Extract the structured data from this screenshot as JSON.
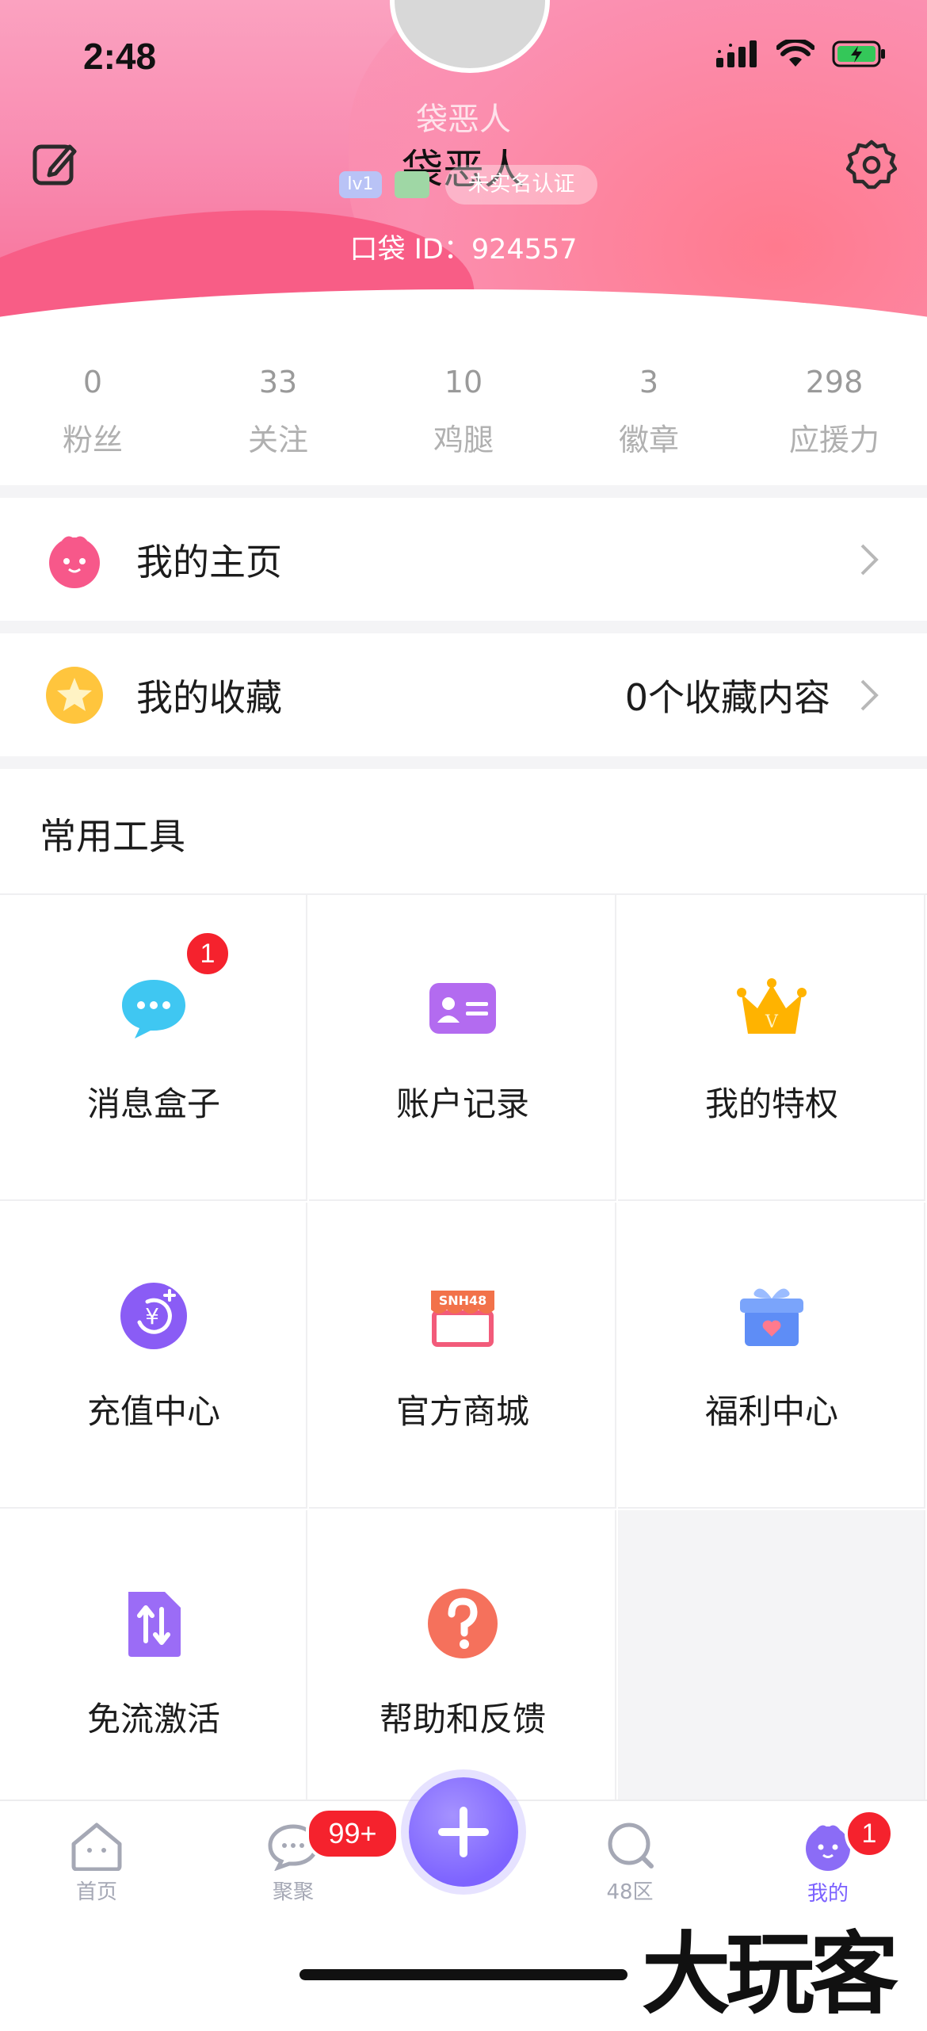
{
  "status_bar": {
    "time": "2:48"
  },
  "profile": {
    "nickname_faint": "袋恶人",
    "nickname": "袋恶人",
    "level_badge": "lv1",
    "verify_label": "未实名认证",
    "pocket_id": "口袋 ID：924557"
  },
  "stats": [
    {
      "num": "0",
      "label": "粉丝"
    },
    {
      "num": "33",
      "label": "关注"
    },
    {
      "num": "10",
      "label": "鸡腿"
    },
    {
      "num": "3",
      "label": "徽章"
    },
    {
      "num": "298",
      "label": "应援力"
    }
  ],
  "rows": {
    "homepage_label": "我的主页",
    "favorites_label": "我的收藏",
    "favorites_value": "0个收藏内容"
  },
  "tools": {
    "title": "常用工具",
    "items": [
      {
        "label": "消息盒子",
        "icon": "chat-bubble-icon",
        "badge": "1"
      },
      {
        "label": "账户记录",
        "icon": "id-card-icon"
      },
      {
        "label": "我的特权",
        "icon": "crown-icon"
      },
      {
        "label": "充值中心",
        "icon": "yuan-coin-icon"
      },
      {
        "label": "官方商城",
        "icon": "shop-icon",
        "icon_text": "SNH48"
      },
      {
        "label": "福利中心",
        "icon": "gift-icon"
      },
      {
        "label": "免流激活",
        "icon": "data-transfer-icon"
      },
      {
        "label": "帮助和反馈",
        "icon": "help-icon"
      }
    ]
  },
  "tabbar": {
    "home": "首页",
    "juju": "聚聚",
    "juju_badge": "99+",
    "zone": "48区",
    "mine": "我的",
    "mine_badge": "1"
  },
  "watermark": "大玩客",
  "colors": {
    "accent": "#7b61ff",
    "badge": "#f5222d",
    "header_pink": "#f98db2"
  }
}
